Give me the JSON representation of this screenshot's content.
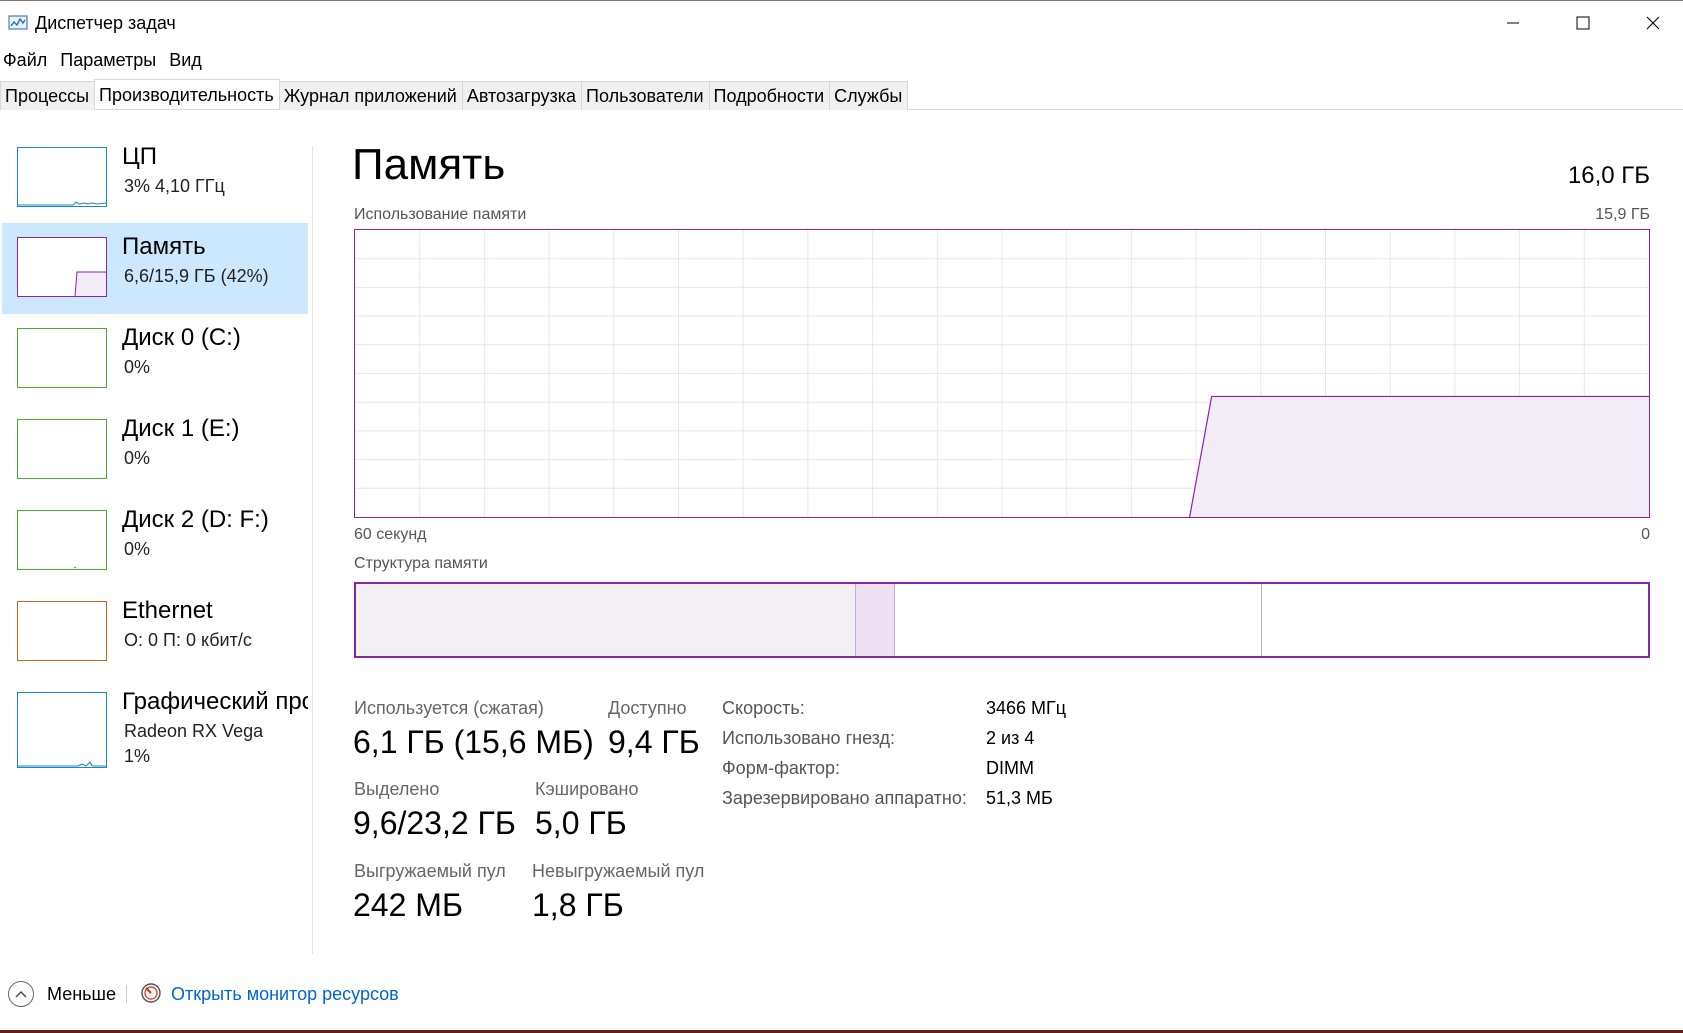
{
  "window": {
    "title": "Диспетчер задач",
    "minimize_icon": "minimize-icon",
    "maximize_icon": "maximize-icon",
    "close_icon": "close-icon"
  },
  "menu": [
    "Файл",
    "Параметры",
    "Вид"
  ],
  "tabs": [
    {
      "label": "Процессы"
    },
    {
      "label": "Производительность",
      "active": true
    },
    {
      "label": "Журнал приложений"
    },
    {
      "label": "Автозагрузка"
    },
    {
      "label": "Пользователи"
    },
    {
      "label": "Подробности"
    },
    {
      "label": "Службы"
    }
  ],
  "sidebar": {
    "items": [
      {
        "title": "ЦП",
        "sub": "3%  4,10 ГГц",
        "sub2": "",
        "color": "#1a86c8"
      },
      {
        "title": "Память",
        "sub": "6,6/15,9 ГБ (42%)",
        "sub2": "",
        "color": "#8b23a9",
        "selected": true
      },
      {
        "title": "Диск 0 (C:)",
        "sub": "0%",
        "sub2": "",
        "color": "#4caf28"
      },
      {
        "title": "Диск 1 (E:)",
        "sub": "0%",
        "sub2": "",
        "color": "#4caf28"
      },
      {
        "title": "Диск 2 (D: F:)",
        "sub": "0%",
        "sub2": "",
        "color": "#4caf28"
      },
      {
        "title": "Ethernet",
        "sub": "О: 0  П: 0 кбит/с",
        "sub2": "",
        "color": "#c8651e"
      },
      {
        "title": "Графический процессор",
        "sub": "Radeon RX Vega",
        "sub2": "1%",
        "color": "#1a86c8"
      }
    ]
  },
  "main": {
    "title": "Память",
    "total": "16,0 ГБ",
    "usage_label": "Использование памяти",
    "usage_max": "15,9 ГБ",
    "time_left": "60 секунд",
    "time_right": "0",
    "structure_label": "Структура памяти",
    "accent_color": "#8b23a9",
    "usage_level_fraction": 0.42,
    "stats": {
      "in_use_label": "Используется (сжатая)",
      "in_use_value": "6,1 ГБ (15,6 МБ)",
      "available_label": "Доступно",
      "available_value": "9,4 ГБ",
      "committed_label": "Выделено",
      "committed_value": "9,6/23,2 ГБ",
      "cached_label": "Кэшировано",
      "cached_value": "5,0 ГБ",
      "paged_label": "Выгружаемый пул",
      "paged_value": "242 МБ",
      "nonpaged_label": "Невыгружаемый пул",
      "nonpaged_value": "1,8 ГБ"
    },
    "specs": {
      "speed_label": "Скорость:",
      "speed_value": "3466 МГц",
      "slots_label": "Использовано гнезд:",
      "slots_value": "2 из 4",
      "form_label": "Форм-фактор:",
      "form_value": "DIMM",
      "reserved_label": "Зарезервировано аппаратно:",
      "reserved_value": "51,3 МБ"
    }
  },
  "footer": {
    "fewer_label": "Меньше",
    "monitor_label": "Открыть монитор ресурсов"
  }
}
